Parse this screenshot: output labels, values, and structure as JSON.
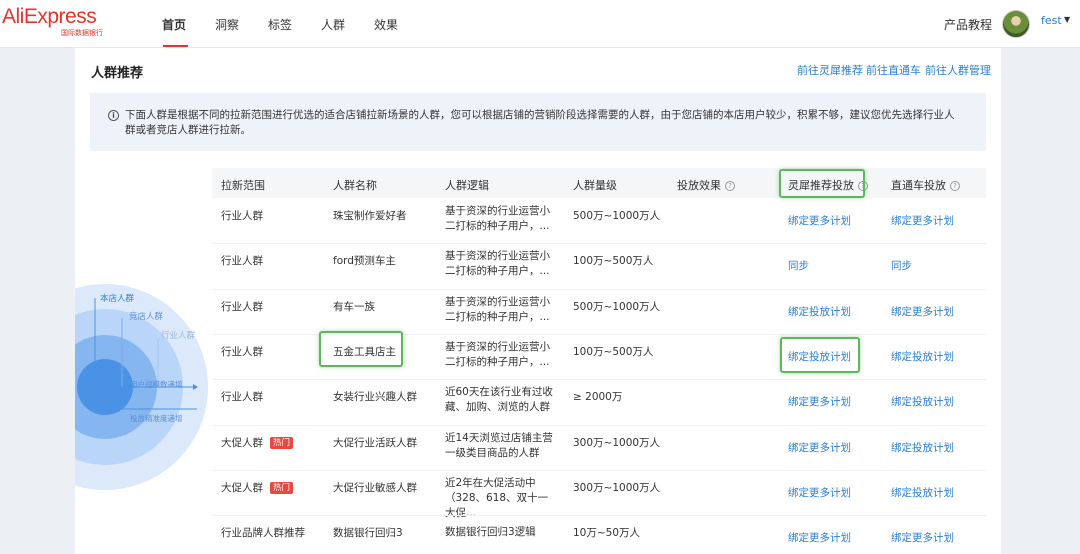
{
  "header": {
    "logo_text": "AliExpress",
    "logo_subtitle": "国际数据银行",
    "nav": [
      "首页",
      "洞察",
      "标签",
      "人群",
      "效果"
    ],
    "tutorial": "产品教程",
    "username": "fest",
    "accent_color": "#e8332a"
  },
  "section": {
    "title": "人群推荐",
    "links": [
      "前往灵犀推荐",
      "前往直通车",
      "前往人群管理"
    ]
  },
  "notice": {
    "icon": "info-icon",
    "text": "下面人群是根据不同的拉新范围进行优选的适合店铺拉新场景的人群，您可以根据店铺的营销阶段选择需要的人群，由于您店铺的本店用户较少，积累不够，建议您优先选择行业人群或者竞店人群进行拉新。"
  },
  "diagram": {
    "labels": [
      "本店人群",
      "竞店人群",
      "行业人群"
    ],
    "arrow_labels": [
      "用户规模数递增",
      "投放精准度递增"
    ]
  },
  "table": {
    "headers": [
      "拉新范围",
      "人群名称",
      "人群逻辑",
      "人群量级",
      "投放效果",
      "灵犀推荐投放",
      "直通车投放"
    ],
    "rows": [
      {
        "scope": "行业人群",
        "hot": "",
        "name": "珠宝制作爱好者",
        "logic": "基于资深的行业运营小二打标的种子用户，...",
        "size": "500万~1000万人",
        "lingxi": "绑定更多计划",
        "ztc": "绑定更多计划"
      },
      {
        "scope": "行业人群",
        "hot": "",
        "name": "ford预测车主",
        "logic": "基于资深的行业运营小二打标的种子用户，...",
        "size": "100万~500万人",
        "lingxi": "同步",
        "ztc": "同步"
      },
      {
        "scope": "行业人群",
        "hot": "",
        "name": "有车一族",
        "logic": "基于资深的行业运营小二打标的种子用户，...",
        "size": "500万~1000万人",
        "lingxi": "绑定投放计划",
        "ztc": "绑定更多计划"
      },
      {
        "scope": "行业人群",
        "hot": "",
        "name": "五金工具店主",
        "logic": "基于资深的行业运营小二打标的种子用户，...",
        "size": "100万~500万人",
        "lingxi": "绑定投放计划",
        "ztc": "绑定投放计划"
      },
      {
        "scope": "行业人群",
        "hot": "",
        "name": "女装行业兴趣人群",
        "logic": "近60天在该行业有过收藏、加购、浏览的人群",
        "size": "≥ 2000万",
        "lingxi": "绑定更多计划",
        "ztc": "绑定投放计划"
      },
      {
        "scope": "大促人群",
        "hot": "热门",
        "name": "大促行业活跃人群",
        "logic": "近14天浏览过店铺主营一级类目商品的人群",
        "size": "300万~1000万人",
        "lingxi": "绑定更多计划",
        "ztc": "绑定投放计划"
      },
      {
        "scope": "大促人群",
        "hot": "热门",
        "name": "大促行业敏感人群",
        "logic": "近2年在大促活动中（328、618、双十一大促...",
        "size": "300万~1000万人",
        "lingxi": "绑定更多计划",
        "ztc": "绑定投放计划"
      },
      {
        "scope": "行业品牌人群推荐",
        "hot": "",
        "name": "数据银行回归3",
        "logic": "数据银行回归3逻辑",
        "size": "10万~50万人",
        "lingxi": "绑定更多计划",
        "ztc": "绑定更多计划"
      }
    ]
  }
}
